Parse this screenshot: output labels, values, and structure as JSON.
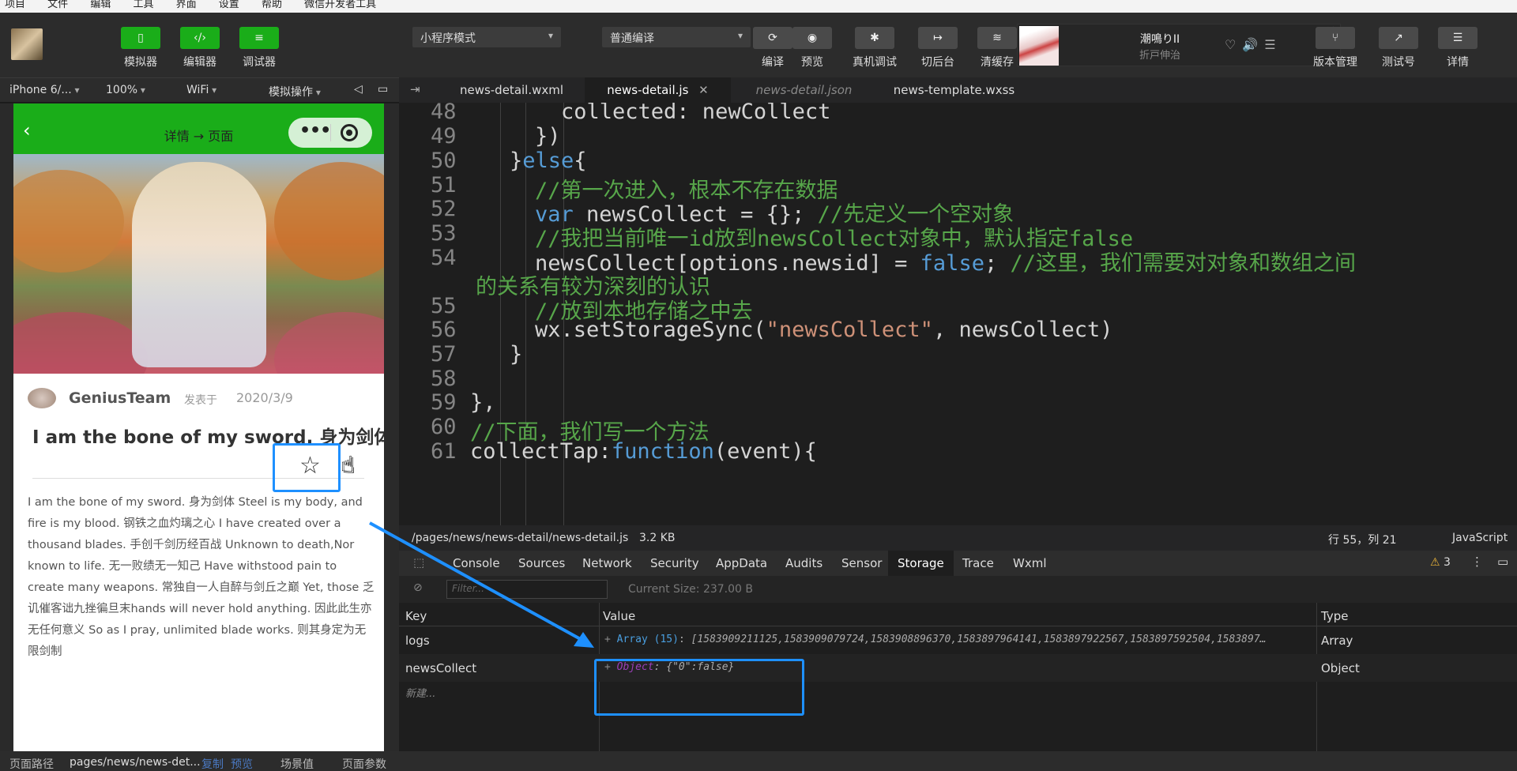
{
  "menu": [
    "项目",
    "文件",
    "编辑",
    "工具",
    "界面",
    "设置",
    "帮助",
    "微信开发者工具"
  ],
  "toolbar": {
    "simulator": "模拟器",
    "editor": "编辑器",
    "debugger": "调试器",
    "mode_select": "小程序模式",
    "compile_select": "普通编译",
    "compile": "编译",
    "preview": "预览",
    "remote_debug": "真机调试",
    "background": "切后台",
    "clear_cache": "清缓存",
    "version": "版本管理",
    "test_account": "测试号",
    "details": "详情"
  },
  "music": {
    "title": "潮鳴りII",
    "artist": "折戸伸治"
  },
  "device_bar": {
    "device": "iPhone 6/...",
    "zoom": "100%",
    "network": "WiFi",
    "ops": "模拟操作"
  },
  "phone": {
    "nav_title": "详情 → 页面",
    "author": "GeniusTeam",
    "published": "发表于",
    "date": "2020/3/9",
    "title": "I am the bone of my sword. 身为剑体",
    "body": "I am the bone of my sword. 身为剑体 Steel is my body, and fire is my blood. 钢铁之血灼璃之心 I have created over a thousand blades. 手创千剑历经百战 Unknown to death,Nor known to life. 无一败绩无一知己 Have withstood pain to create many weapons. 常独自一人自醉与剑丘之巅 Yet, those 乏讥催客诎九挫徧旦末hands will never hold anything. 因此此生亦无任何意义 So as I pray, unlimited blade works. 则其身定为无限剑制"
  },
  "tabs": [
    "news-detail.wxml",
    "news-detail.js",
    "news-detail.json",
    "news-template.wxss"
  ],
  "code": {
    "line_numbers": [
      "48",
      "49",
      "50",
      "51",
      "52",
      "53",
      "54",
      "55",
      "56",
      "57",
      "58",
      "59",
      "60",
      "61"
    ],
    "l48": "collected: newCollect",
    "l49": "})",
    "l50a": "}",
    "l50b": "else",
    "l50c": "{",
    "l51": "//第一次进入，根本不存在数据",
    "l52a": "var",
    "l52b": " newsCollect = {}; ",
    "l52c": "//先定义一个空对象",
    "l53": "//我把当前唯一id放到newsCollect对象中，默认指定false",
    "l54a": "newsCollect[options.newsid] = ",
    "l54b": "false",
    "l54c": "; ",
    "l54d": "//这里，我们需要对对象和数组之间",
    "l54e": "的关系有较为深刻的认识",
    "l55": "//放到本地存储之中去",
    "l56a": "wx.setStorageSync(",
    "l56b": "\"newsCollect\"",
    "l56c": ", newsCollect)",
    "l57": "}",
    "l59": "},",
    "l60": "//下面，我们写一个方法",
    "l61a": "collectTap:",
    "l61b": "function",
    "l61c": "(event){"
  },
  "status": {
    "path": "/pages/news/news-detail/news-detail.js",
    "size": "3.2 KB",
    "pos": "行 55，列 21",
    "lang": "JavaScript"
  },
  "devtools": {
    "tabs": [
      "Console",
      "Sources",
      "Network",
      "Security",
      "AppData",
      "Audits",
      "Sensor",
      "Storage",
      "Trace",
      "Wxml"
    ],
    "warn_count": "3",
    "filter_placeholder": "Filter...",
    "current_size": "Current Size: 237.00 B",
    "headers": {
      "key": "Key",
      "value": "Value",
      "type": "Type"
    },
    "rows": [
      {
        "key": "logs",
        "value_type": "Array (15)",
        "value": "[1583909211125,1583909079724,1583908896370,1583897964141,1583897922567,1583897592504,1583897…",
        "type": "Array"
      },
      {
        "key": "newsCollect",
        "value_type": "Object",
        "value": "{\"0\":false}",
        "type": "Object"
      }
    ],
    "new_row": "新建..."
  },
  "bottom": {
    "label_path": "页面路径",
    "path": "pages/news/news-det...",
    "copy": "复制",
    "preview": "预览",
    "scene": "场景值",
    "params": "页面参数"
  },
  "colors": {
    "wechat_green": "#1aad19",
    "highlight_blue": "#1e90ff"
  }
}
